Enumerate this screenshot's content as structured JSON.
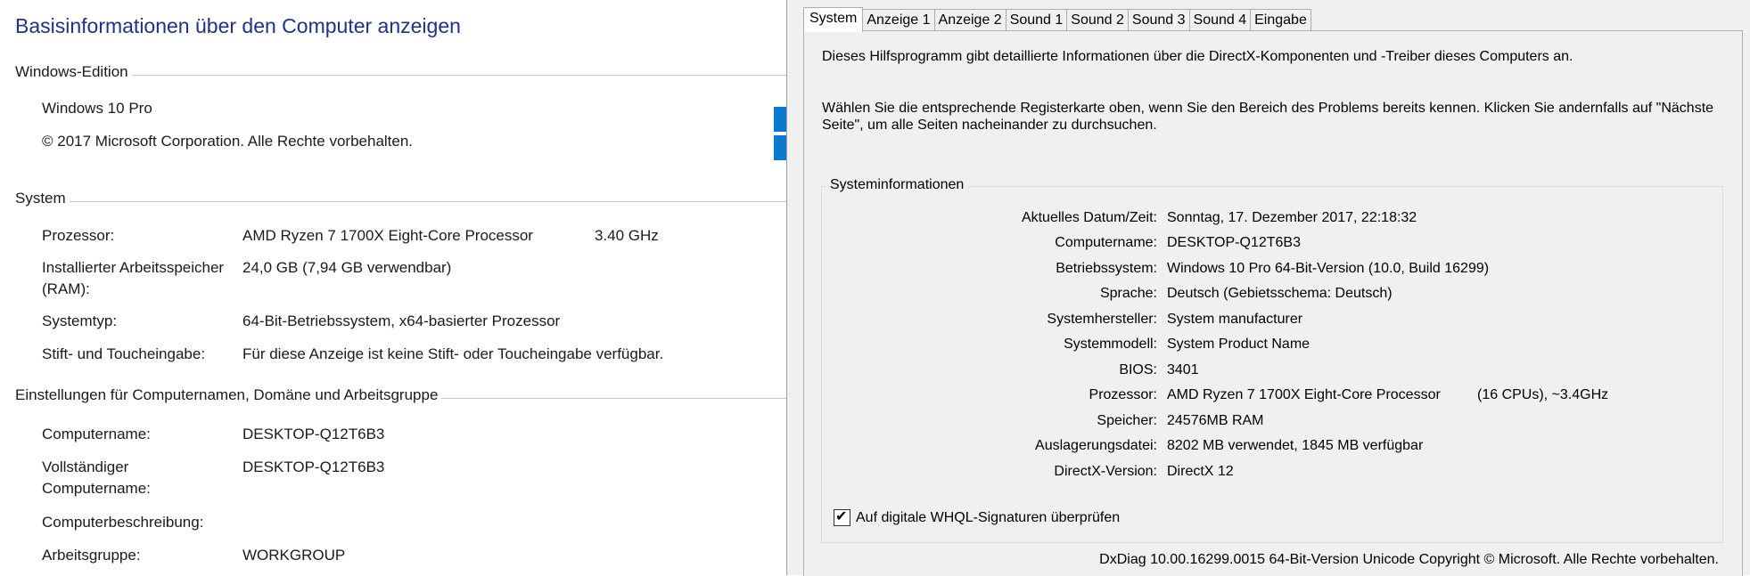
{
  "left": {
    "title": "Basisinformationen über den Computer anzeigen",
    "edition": {
      "heading": "Windows-Edition",
      "name": "Windows 10 Pro",
      "copyright": "© 2017 Microsoft Corporation. Alle Rechte vorbehalten."
    },
    "system": {
      "heading": "System",
      "rows": [
        {
          "label": "Prozessor:",
          "value": "AMD Ryzen 7 1700X Eight-Core Processor",
          "extra": "3.40 GHz"
        },
        {
          "label": "Installierter Arbeitsspeicher (RAM):",
          "value": "24,0 GB (7,94 GB verwendbar)"
        },
        {
          "label": "Systemtyp:",
          "value": "64-Bit-Betriebssystem, x64-basierter Prozessor"
        },
        {
          "label": "Stift- und Toucheingabe:",
          "value": "Für diese Anzeige ist keine Stift- oder Toucheingabe verfügbar."
        }
      ]
    },
    "computer": {
      "heading": "Einstellungen für Computernamen, Domäne und Arbeitsgruppe",
      "rows": [
        {
          "label": "Computername:",
          "value": "DESKTOP-Q12T6B3"
        },
        {
          "label": "Vollständiger Computername:",
          "value": "DESKTOP-Q12T6B3"
        },
        {
          "label": "Computerbeschreibung:",
          "value": ""
        },
        {
          "label": "Arbeitsgruppe:",
          "value": "WORKGROUP"
        }
      ]
    }
  },
  "dxdiag": {
    "tabs": [
      "System",
      "Anzeige 1",
      "Anzeige 2",
      "Sound 1",
      "Sound 2",
      "Sound 3",
      "Sound 4",
      "Eingabe"
    ],
    "intro1": "Dieses Hilfsprogramm gibt detaillierte Informationen über die DirectX-Komponenten und -Treiber dieses Computers an.",
    "intro2": "Wählen Sie die entsprechende Registerkarte oben, wenn Sie den Bereich des Problems bereits kennen. Klicken Sie andernfalls auf \"Nächste Seite\", um alle Seiten nacheinander zu durchsuchen.",
    "group_title": "Systeminformationen",
    "rows": [
      {
        "label": "Aktuelles Datum/Zeit:",
        "value": "Sonntag, 17. Dezember 2017, 22:18:32"
      },
      {
        "label": "Computername:",
        "value": "DESKTOP-Q12T6B3"
      },
      {
        "label": "Betriebssystem:",
        "value": "Windows 10 Pro 64-Bit-Version (10.0, Build 16299)"
      },
      {
        "label": "Sprache:",
        "value": "Deutsch (Gebietsschema: Deutsch)"
      },
      {
        "label": "Systemhersteller:",
        "value": "System manufacturer"
      },
      {
        "label": "Systemmodell:",
        "value": "System Product Name"
      },
      {
        "label": "BIOS:",
        "value": "3401"
      },
      {
        "label": "Prozessor:",
        "value": "AMD Ryzen 7 1700X Eight-Core Processor",
        "extra": "(16 CPUs), ~3.4GHz"
      },
      {
        "label": "Speicher:",
        "value": "24576MB RAM"
      },
      {
        "label": "Auslagerungsdatei:",
        "value": "8202 MB verwendet, 1845 MB verfügbar"
      },
      {
        "label": "DirectX-Version:",
        "value": "DirectX 12"
      }
    ],
    "whql_checkbox": {
      "label": "Auf digitale WHQL-Signaturen überprüfen",
      "checked": true
    },
    "footer": "DxDiag 10.00.16299.0015 64-Bit-Version Unicode Copyright © Microsoft. Alle Rechte vorbehalten."
  },
  "colors": {
    "title_blue": "#1e3287",
    "windows_logo": "#0a7ad1"
  },
  "icons": [
    "windows-logo-icon",
    "checkmark-icon"
  ]
}
